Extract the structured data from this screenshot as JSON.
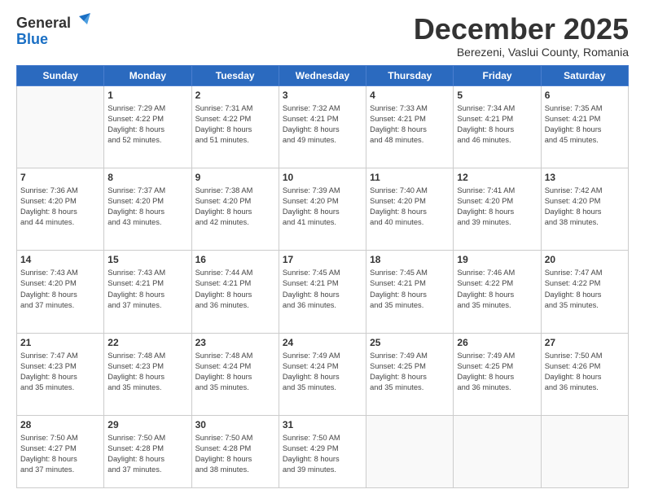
{
  "header": {
    "logo_line1": "General",
    "logo_line2": "Blue",
    "month_title": "December 2025",
    "subtitle": "Berezeni, Vaslui County, Romania"
  },
  "weekdays": [
    "Sunday",
    "Monday",
    "Tuesday",
    "Wednesday",
    "Thursday",
    "Friday",
    "Saturday"
  ],
  "weeks": [
    [
      {
        "day": "",
        "info": ""
      },
      {
        "day": "1",
        "info": "Sunrise: 7:29 AM\nSunset: 4:22 PM\nDaylight: 8 hours\nand 52 minutes."
      },
      {
        "day": "2",
        "info": "Sunrise: 7:31 AM\nSunset: 4:22 PM\nDaylight: 8 hours\nand 51 minutes."
      },
      {
        "day": "3",
        "info": "Sunrise: 7:32 AM\nSunset: 4:21 PM\nDaylight: 8 hours\nand 49 minutes."
      },
      {
        "day": "4",
        "info": "Sunrise: 7:33 AM\nSunset: 4:21 PM\nDaylight: 8 hours\nand 48 minutes."
      },
      {
        "day": "5",
        "info": "Sunrise: 7:34 AM\nSunset: 4:21 PM\nDaylight: 8 hours\nand 46 minutes."
      },
      {
        "day": "6",
        "info": "Sunrise: 7:35 AM\nSunset: 4:21 PM\nDaylight: 8 hours\nand 45 minutes."
      }
    ],
    [
      {
        "day": "7",
        "info": "Sunrise: 7:36 AM\nSunset: 4:20 PM\nDaylight: 8 hours\nand 44 minutes."
      },
      {
        "day": "8",
        "info": "Sunrise: 7:37 AM\nSunset: 4:20 PM\nDaylight: 8 hours\nand 43 minutes."
      },
      {
        "day": "9",
        "info": "Sunrise: 7:38 AM\nSunset: 4:20 PM\nDaylight: 8 hours\nand 42 minutes."
      },
      {
        "day": "10",
        "info": "Sunrise: 7:39 AM\nSunset: 4:20 PM\nDaylight: 8 hours\nand 41 minutes."
      },
      {
        "day": "11",
        "info": "Sunrise: 7:40 AM\nSunset: 4:20 PM\nDaylight: 8 hours\nand 40 minutes."
      },
      {
        "day": "12",
        "info": "Sunrise: 7:41 AM\nSunset: 4:20 PM\nDaylight: 8 hours\nand 39 minutes."
      },
      {
        "day": "13",
        "info": "Sunrise: 7:42 AM\nSunset: 4:20 PM\nDaylight: 8 hours\nand 38 minutes."
      }
    ],
    [
      {
        "day": "14",
        "info": "Sunrise: 7:43 AM\nSunset: 4:20 PM\nDaylight: 8 hours\nand 37 minutes."
      },
      {
        "day": "15",
        "info": "Sunrise: 7:43 AM\nSunset: 4:21 PM\nDaylight: 8 hours\nand 37 minutes."
      },
      {
        "day": "16",
        "info": "Sunrise: 7:44 AM\nSunset: 4:21 PM\nDaylight: 8 hours\nand 36 minutes."
      },
      {
        "day": "17",
        "info": "Sunrise: 7:45 AM\nSunset: 4:21 PM\nDaylight: 8 hours\nand 36 minutes."
      },
      {
        "day": "18",
        "info": "Sunrise: 7:45 AM\nSunset: 4:21 PM\nDaylight: 8 hours\nand 35 minutes."
      },
      {
        "day": "19",
        "info": "Sunrise: 7:46 AM\nSunset: 4:22 PM\nDaylight: 8 hours\nand 35 minutes."
      },
      {
        "day": "20",
        "info": "Sunrise: 7:47 AM\nSunset: 4:22 PM\nDaylight: 8 hours\nand 35 minutes."
      }
    ],
    [
      {
        "day": "21",
        "info": "Sunrise: 7:47 AM\nSunset: 4:23 PM\nDaylight: 8 hours\nand 35 minutes."
      },
      {
        "day": "22",
        "info": "Sunrise: 7:48 AM\nSunset: 4:23 PM\nDaylight: 8 hours\nand 35 minutes."
      },
      {
        "day": "23",
        "info": "Sunrise: 7:48 AM\nSunset: 4:24 PM\nDaylight: 8 hours\nand 35 minutes."
      },
      {
        "day": "24",
        "info": "Sunrise: 7:49 AM\nSunset: 4:24 PM\nDaylight: 8 hours\nand 35 minutes."
      },
      {
        "day": "25",
        "info": "Sunrise: 7:49 AM\nSunset: 4:25 PM\nDaylight: 8 hours\nand 35 minutes."
      },
      {
        "day": "26",
        "info": "Sunrise: 7:49 AM\nSunset: 4:25 PM\nDaylight: 8 hours\nand 36 minutes."
      },
      {
        "day": "27",
        "info": "Sunrise: 7:50 AM\nSunset: 4:26 PM\nDaylight: 8 hours\nand 36 minutes."
      }
    ],
    [
      {
        "day": "28",
        "info": "Sunrise: 7:50 AM\nSunset: 4:27 PM\nDaylight: 8 hours\nand 37 minutes."
      },
      {
        "day": "29",
        "info": "Sunrise: 7:50 AM\nSunset: 4:28 PM\nDaylight: 8 hours\nand 37 minutes."
      },
      {
        "day": "30",
        "info": "Sunrise: 7:50 AM\nSunset: 4:28 PM\nDaylight: 8 hours\nand 38 minutes."
      },
      {
        "day": "31",
        "info": "Sunrise: 7:50 AM\nSunset: 4:29 PM\nDaylight: 8 hours\nand 39 minutes."
      },
      {
        "day": "",
        "info": ""
      },
      {
        "day": "",
        "info": ""
      },
      {
        "day": "",
        "info": ""
      }
    ]
  ]
}
